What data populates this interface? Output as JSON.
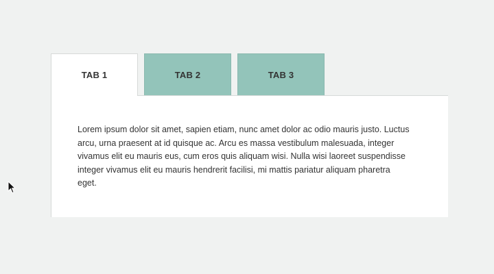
{
  "tabs": [
    {
      "label": "TAB 1",
      "active": true
    },
    {
      "label": "TAB 2",
      "active": false
    },
    {
      "label": "TAB 3",
      "active": false
    }
  ],
  "panel": {
    "text": "Lorem ipsum dolor sit amet, sapien etiam, nunc amet dolor ac odio mauris justo. Luctus arcu, urna praesent at id quisque ac. Arcu es massa vestibulum malesuada, integer vivamus elit eu mauris eus, cum eros quis aliquam wisi. Nulla wisi laoreet suspendisse integer vivamus elit eu mauris hendrerit facilisi, mi mattis pariatur aliquam pharetra eget."
  },
  "colors": {
    "background": "#f0f2f1",
    "active_tab": "#ffffff",
    "inactive_tab": "#93c4ba",
    "text": "#333333"
  },
  "cursor": {
    "icon": "mouse-pointer-icon"
  }
}
